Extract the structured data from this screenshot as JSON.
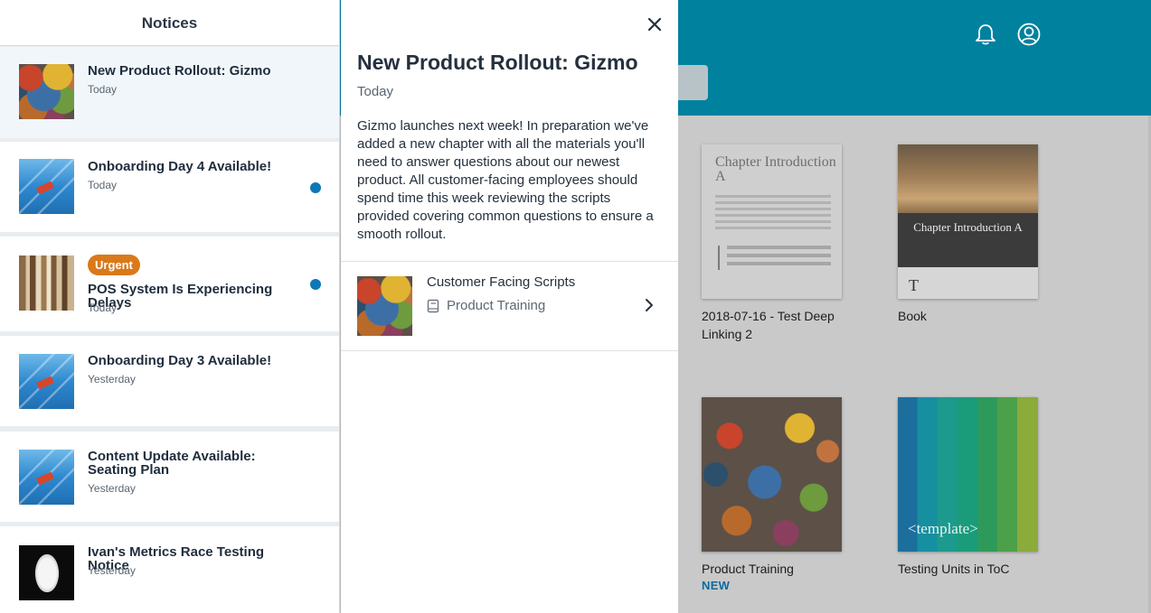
{
  "notices_panel": {
    "title": "Notices",
    "items": [
      {
        "title": "New Product Rollout: Gizmo",
        "date": "Today",
        "image": "puzzle-image",
        "unread": false,
        "badge": "",
        "selected": true
      },
      {
        "title": "Onboarding Day 4 Available!",
        "date": "Today",
        "image": "stadium-seats-image",
        "unread": true,
        "badge": "",
        "selected": false
      },
      {
        "title": "POS System Is Experiencing Delays",
        "date": "Today",
        "image": "books-image",
        "unread": true,
        "badge": "Urgent",
        "selected": false
      },
      {
        "title": "Onboarding Day 3 Available!",
        "date": "Yesterday",
        "image": "stadium-seats-image",
        "unread": false,
        "badge": "",
        "selected": false
      },
      {
        "title": "Content Update Available: Seating Plan",
        "date": "Yesterday",
        "image": "stadium-seats-image",
        "unread": false,
        "badge": "",
        "selected": false
      },
      {
        "title": "Ivan's Metrics Race Testing Notice",
        "date": "Yesterday",
        "image": "bird-image",
        "unread": false,
        "badge": "",
        "selected": false
      }
    ]
  },
  "detail": {
    "title": "New Product Rollout: Gizmo",
    "date": "Today",
    "body": "Gizmo launches next week! In preparation we've added a new chapter with all the materials you'll need to answer questions about our newest product. All customer-facing employees should spend time this week reviewing the scripts provided covering common questions to ensure a smooth rollout.",
    "link": {
      "title": "Customer Facing Scripts",
      "subtitle": "Product Training",
      "icon": "book-icon"
    },
    "close_icon": "close-icon"
  },
  "background": {
    "header_icons": [
      "bell-icon",
      "user-circle-icon"
    ],
    "header_color": "#00819e",
    "cards": [
      {
        "caption": "2018-07-16 - Test Deep Linking 2",
        "thumb_title": "Chapter Introduction A",
        "tag": ""
      },
      {
        "caption": "Book",
        "thumb_title": "Chapter Introduction A",
        "thumb_letter": "T",
        "tag": ""
      },
      {
        "caption": "Product Training",
        "tag": "NEW"
      },
      {
        "caption": "Testing Units in ToC",
        "thumb_title": "<template>",
        "tag": ""
      }
    ]
  },
  "colors": {
    "accent_dot": "#0d78b6",
    "urgent_badge": "#d9791a",
    "new_tag": "#0b6aa0"
  }
}
